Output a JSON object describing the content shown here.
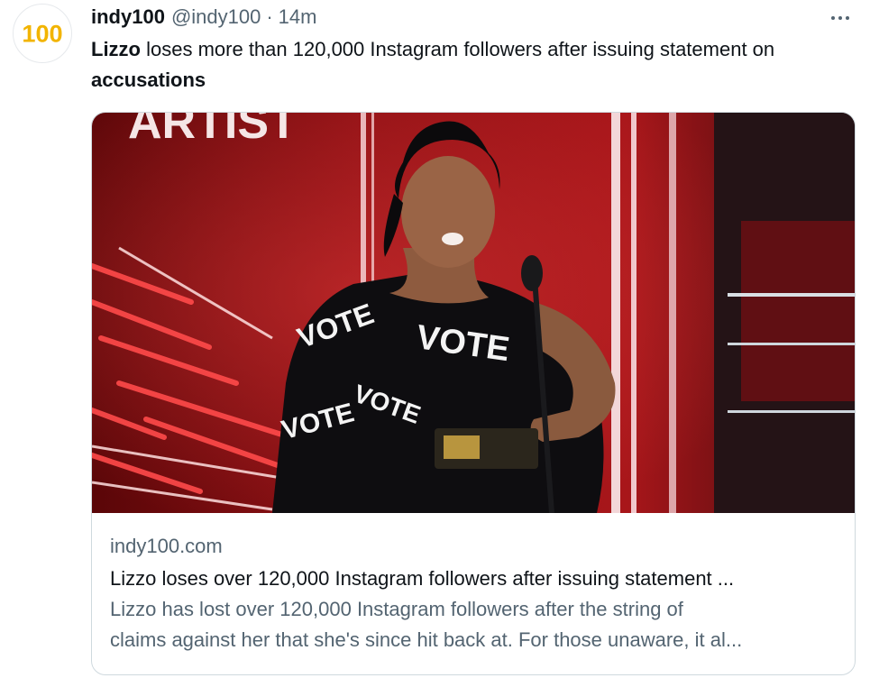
{
  "tweet": {
    "avatar_label": "100",
    "display_name": "indy100",
    "handle": "@indy100",
    "separator": "·",
    "time": "14m",
    "text_parts": {
      "p1": "Lizzo",
      "p2": " loses more than 120,000 Instagram followers after issuing statement on ",
      "p3": "accusations"
    }
  },
  "card": {
    "image_text": [
      "ARTIST",
      "VOTE"
    ],
    "domain": "indy100.com",
    "title": "Lizzo loses over 120,000 Instagram followers after issuing statement ...",
    "description_line1": "Lizzo has lost over 120,000 Instagram followers after the string of",
    "description_line2": "claims against her that she's since hit back at. For those unaware, it al..."
  },
  "colors": {
    "text_primary": "#0f1419",
    "text_secondary": "#536471",
    "border": "#cfd9de",
    "stage_red": "#b3151b"
  },
  "icons": {
    "more": "more-horizontal-icon"
  }
}
